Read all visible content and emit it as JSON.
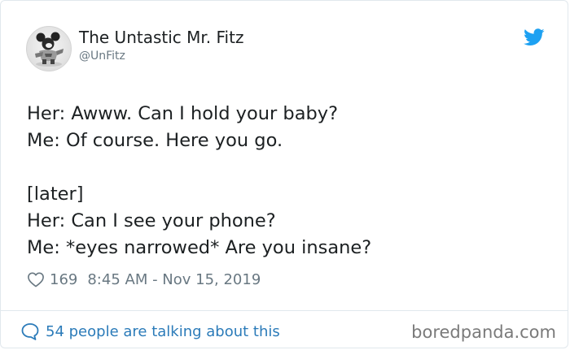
{
  "author": {
    "display_name": "The Untastic Mr. Fitz",
    "handle": "@UnFitz"
  },
  "tweet": {
    "lines": [
      "Her: Awww. Can I hold your baby?",
      "Me: Of course. Here you go.",
      "",
      "[later]",
      "Her: Can I see your phone?",
      "Me: *eyes narrowed* Are you insane?"
    ]
  },
  "stats": {
    "likes": "169",
    "timestamp": "8:45 AM - Nov 15, 2019"
  },
  "footer": {
    "conversation_text": "54 people are talking about this"
  },
  "watermark": "boredpanda.com",
  "colors": {
    "twitter_blue": "#1da1f2",
    "link_blue": "#2b7bb9",
    "muted_gray": "#697882",
    "text_dark": "#1c2022",
    "border": "#e1e8ed"
  },
  "icons": {
    "brand": "twitter-bird-icon",
    "like": "heart-icon",
    "reply": "speech-bubble-icon"
  }
}
